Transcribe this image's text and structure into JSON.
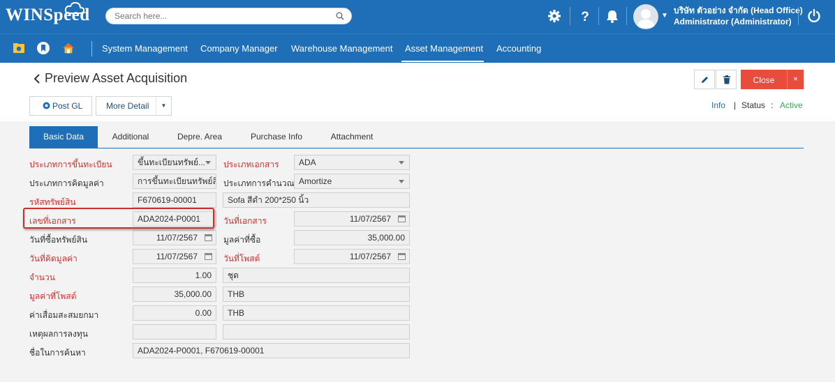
{
  "header": {
    "logo_text": "WINSpeed",
    "search_placeholder": "Search here...",
    "company_name": "บริษัท ตัวอย่าง จำกัด (Head Office)",
    "user_name": "Administrator (Administrator)",
    "icons": [
      "gear-icon",
      "help-icon",
      "bell-icon",
      "avatar",
      "power-icon"
    ],
    "brand_color": "#1e6fb8"
  },
  "nav": {
    "items": [
      "System Management",
      "Company Manager",
      "Warehouse Management",
      "Asset Management",
      "Accounting"
    ],
    "active": "Asset Management"
  },
  "page": {
    "title": "Preview Asset Acquisition",
    "close_label": "Close",
    "close_x": "×",
    "post_gl_label": "Post GL",
    "more_detail_label": "More Detail",
    "info_label": "Info",
    "status_sep": "|",
    "status_label": "Status",
    "status_colon": ":",
    "status_value": "Active",
    "status_color": "#3aa75a",
    "close_color": "#e74c3c"
  },
  "tabs": [
    "Basic Data",
    "Additional",
    "Depre. Area",
    "Purchase Info",
    "Attachment"
  ],
  "form": {
    "reg_type_label": "ประเภทการขึ้นทะเบียน",
    "reg_type_value": "ขึ้นทะเบียนทรัพย์...",
    "doc_type_label": "ประเภทเอกสาร",
    "doc_type_value": "ADA",
    "calc_type_label": "ประเภทการคิดมูลค่า",
    "calc_type_value": "การขึ้นทะเบียนทรัพย์สิ",
    "calc_method_label": "ประเภทการคำนวณ",
    "calc_method_value": "Amortize",
    "asset_code_label": "รหัสทรัพย์สิน",
    "asset_code_value": "F670619-00001",
    "asset_name_value": "Sofa สีดำ 200*250 นิ้ว",
    "doc_no_label": "เลขที่เอกสาร",
    "doc_no_value": "ADA2024-P0001",
    "doc_date_label": "วันที่เอกสาร",
    "doc_date_value": "11/07/2567",
    "purchase_date_label": "วันที่ซื้อทรัพย์สิน",
    "purchase_date_value": "11/07/2567",
    "purchase_value_label": "มูลค่าที่ซื้อ",
    "purchase_value_value": "35,000.00",
    "calc_date_label": "วันที่คิดมูลค่า",
    "calc_date_value": "11/07/2567",
    "post_date_label": "วันที่โพสต์",
    "post_date_value": "11/07/2567",
    "qty_label": "จำนวน",
    "qty_value": "1.00",
    "unit_value": "ชุด",
    "post_value_label": "มูลค่าที่โพสต์",
    "post_value_value": "35,000.00",
    "post_currency_value": "THB",
    "accum_dep_label": "ค่าเสื่อมสะสมยกมา",
    "accum_dep_value": "0.00",
    "accum_currency_value": "THB",
    "reason_label": "เหตุผลการลงทุน",
    "reason_value": "",
    "reason_value2": "",
    "search_name_label": "ชื่อในการค้นหา",
    "search_name_value": "ADA2024-P0001, F670619-00001"
  }
}
